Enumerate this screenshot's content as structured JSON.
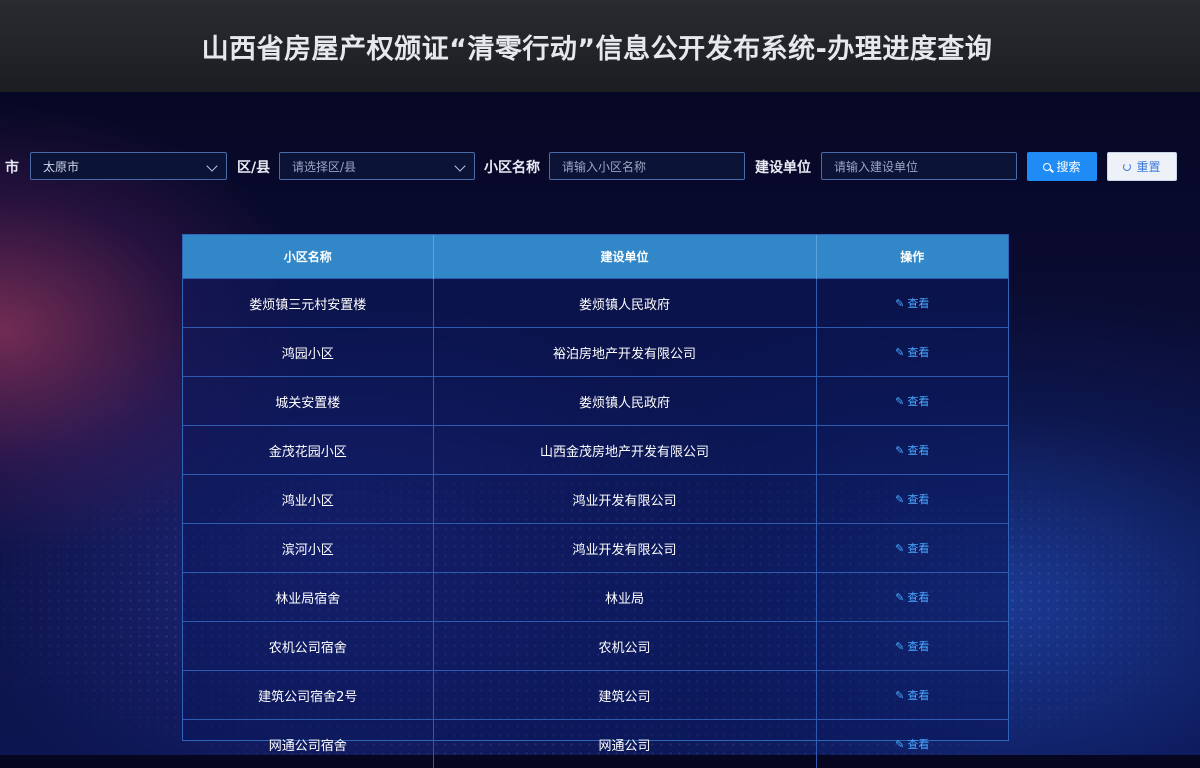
{
  "header": {
    "title": "山西省房屋产权颁证“清零行动”信息公开发布系统-办理进度查询"
  },
  "filters": {
    "city_label": "市",
    "city_value": "太原市",
    "district_label": "区/县",
    "district_placeholder": "请选择区/县",
    "community_label": "小区名称",
    "community_placeholder": "请输入小区名称",
    "builder_label": "建设单位",
    "builder_placeholder": "请输入建设单位",
    "search_label": "搜索",
    "reset_label": "重置"
  },
  "table": {
    "columns": [
      "小区名称",
      "建设单位",
      "操作"
    ],
    "action_label": "查看",
    "rows": [
      {
        "name": "娄烦镇三元村安置楼",
        "builder": "娄烦镇人民政府"
      },
      {
        "name": "鸿园小区",
        "builder": "裕泊房地产开发有限公司"
      },
      {
        "name": "城关安置楼",
        "builder": "娄烦镇人民政府"
      },
      {
        "name": "金茂花园小区",
        "builder": "山西金茂房地产开发有限公司"
      },
      {
        "name": "鸿业小区",
        "builder": "鸿业开发有限公司"
      },
      {
        "name": "滨河小区",
        "builder": "鸿业开发有限公司"
      },
      {
        "name": "林业局宿舍",
        "builder": "林业局"
      },
      {
        "name": "农机公司宿舍",
        "builder": "农机公司"
      },
      {
        "name": "建筑公司宿舍2号",
        "builder": "建筑公司"
      },
      {
        "name": "网通公司宿舍",
        "builder": "网通公司"
      }
    ]
  },
  "colors": {
    "accent": "#1f8cf5",
    "table_header": "#3187c8",
    "link": "#4aa8ff"
  }
}
